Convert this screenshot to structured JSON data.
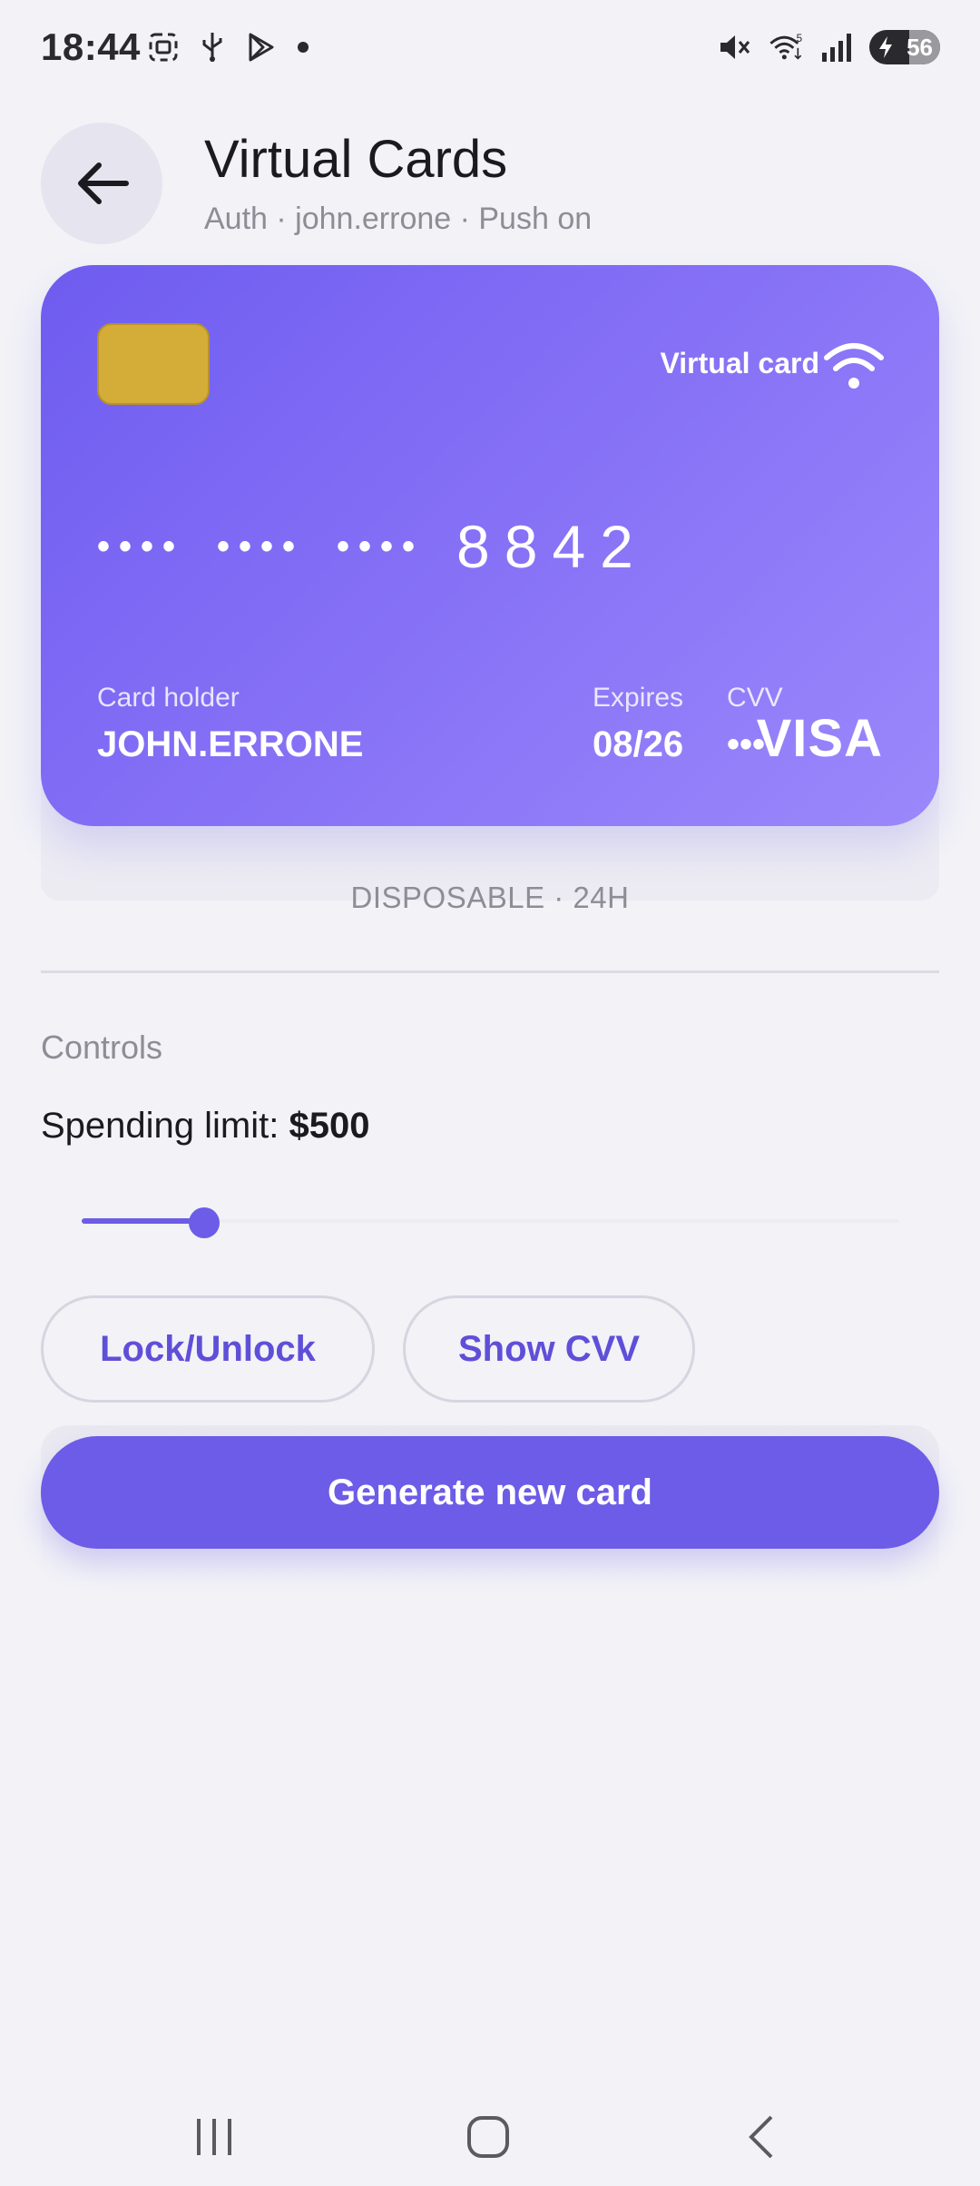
{
  "status_bar": {
    "time": "18:44",
    "left_icons": [
      "screenshot-icon",
      "usb-icon",
      "play-store-icon",
      "notification-dot"
    ],
    "right_icons": [
      "mute-icon",
      "wifi-icon",
      "signal-icon"
    ],
    "battery_level": "56"
  },
  "header": {
    "title": "Virtual Cards",
    "subtitle": "Auth · john.errone · Push on"
  },
  "card": {
    "type_label": "Virtual card",
    "masked_groups": [
      "••••",
      "••••",
      "••••"
    ],
    "last4": "8842",
    "holder_label": "Card holder",
    "holder_value": "JOHN.ERRONE",
    "expires_label": "Expires",
    "expires_value": "08/26",
    "cvv_label": "CVV",
    "cvv_value": "•••",
    "brand": "VISA",
    "gradient": [
      "#6e5cf0",
      "#9b88fb"
    ],
    "chip_color": "#d3ad37"
  },
  "card_meta": "DISPOSABLE · 24H",
  "controls": {
    "title": "Controls",
    "limit_label": "Spending limit: ",
    "limit_value": "$500",
    "slider_fraction": 0.15,
    "lock_button": "Lock/Unlock",
    "cvv_button": "Show CVV"
  },
  "generate_button": "Generate new card",
  "colors": {
    "accent": "#6c5ce7",
    "background": "#f2f2f7",
    "muted_text": "#8e8d96"
  },
  "nav": {
    "items": [
      "recent-apps-icon",
      "home-icon",
      "back-icon"
    ]
  }
}
